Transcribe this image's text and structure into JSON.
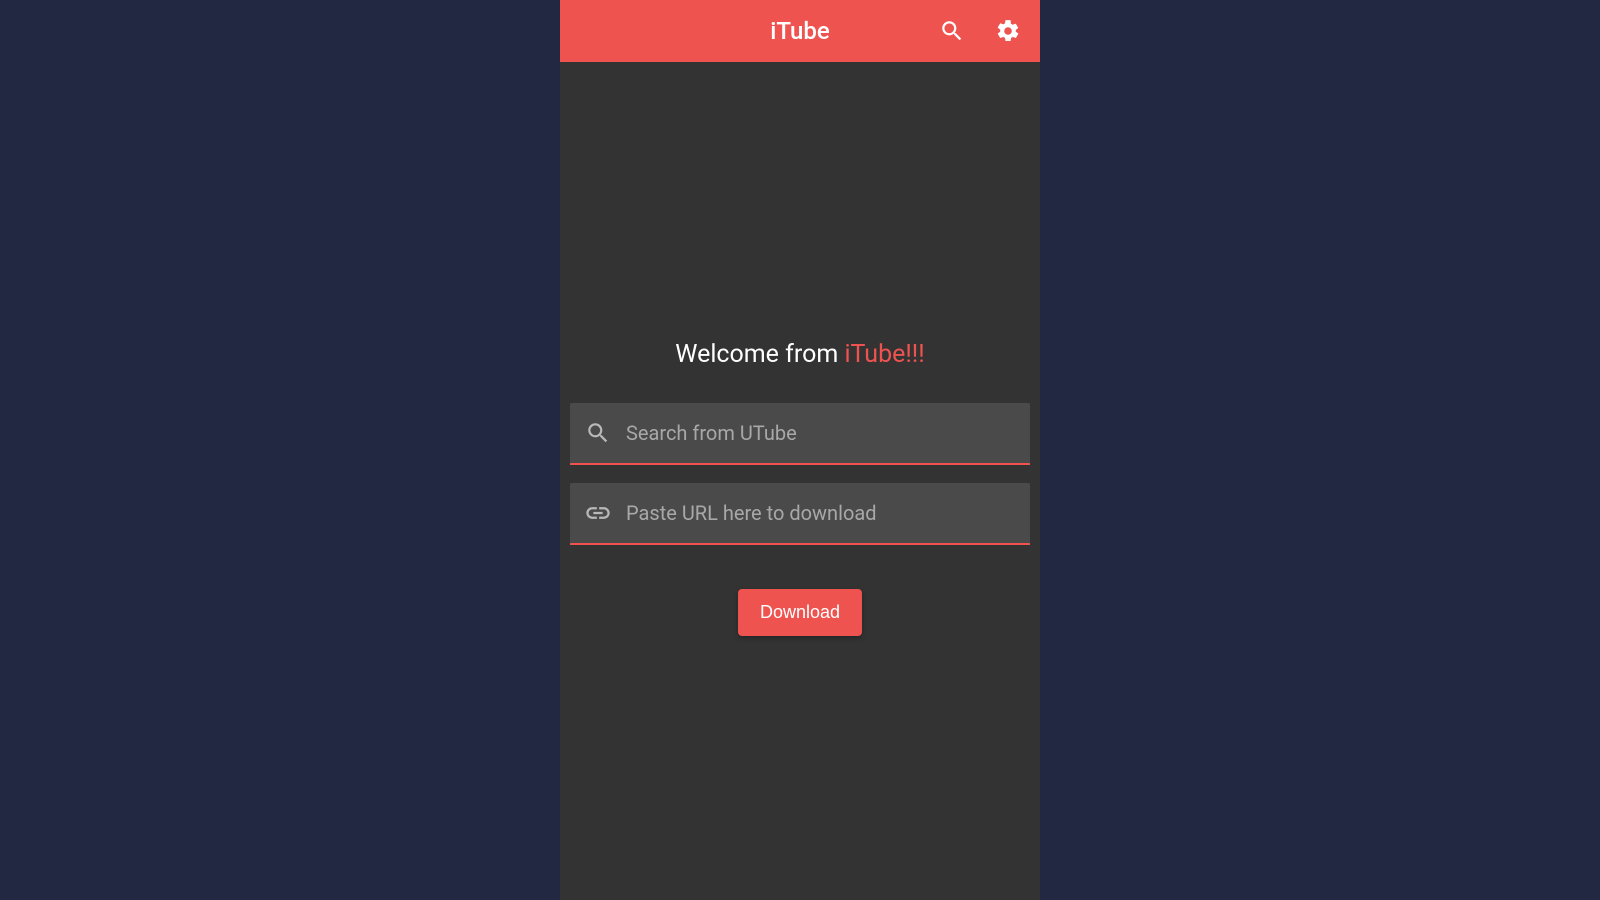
{
  "header": {
    "title": "iTube"
  },
  "main": {
    "welcome_prefix": "Welcome from ",
    "welcome_accent": "iTube!!!",
    "search_placeholder": "Search from UTube",
    "url_placeholder": "Paste URL here to download",
    "download_label": "Download"
  },
  "colors": {
    "accent": "#ef5350",
    "background": "#333333",
    "page_background": "#222842",
    "input_background": "#4a4a4a"
  }
}
